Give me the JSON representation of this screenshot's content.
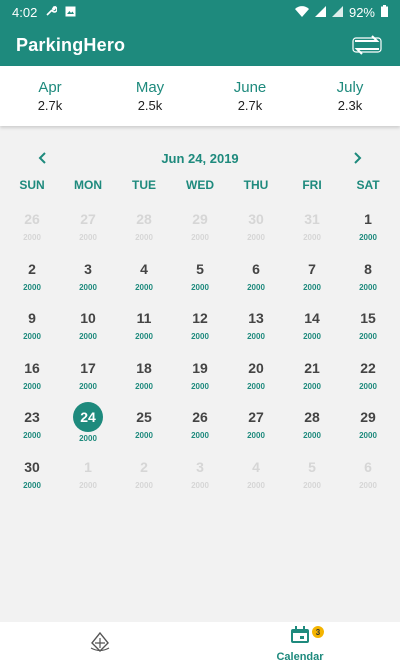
{
  "status_bar": {
    "time": "4:02",
    "battery": "92%"
  },
  "app_bar": {
    "title": "ParkingHero"
  },
  "months": [
    {
      "name": "Apr",
      "value": "2.7k"
    },
    {
      "name": "May",
      "value": "2.5k"
    },
    {
      "name": "June",
      "value": "2.7k"
    },
    {
      "name": "July",
      "value": "2.3k"
    }
  ],
  "calendar": {
    "current_date": "Jun 24, 2019",
    "weekdays": [
      "SUN",
      "MON",
      "TUE",
      "WED",
      "THU",
      "FRI",
      "SAT"
    ],
    "weeks": [
      [
        {
          "d": "26",
          "s": "2000",
          "m": true
        },
        {
          "d": "27",
          "s": "2000",
          "m": true
        },
        {
          "d": "28",
          "s": "2000",
          "m": true
        },
        {
          "d": "29",
          "s": "2000",
          "m": true
        },
        {
          "d": "30",
          "s": "2000",
          "m": true
        },
        {
          "d": "31",
          "s": "2000",
          "m": true
        },
        {
          "d": "1",
          "s": "2000",
          "m": false
        }
      ],
      [
        {
          "d": "2",
          "s": "2000",
          "m": false
        },
        {
          "d": "3",
          "s": "2000",
          "m": false
        },
        {
          "d": "4",
          "s": "2000",
          "m": false
        },
        {
          "d": "5",
          "s": "2000",
          "m": false
        },
        {
          "d": "6",
          "s": "2000",
          "m": false
        },
        {
          "d": "7",
          "s": "2000",
          "m": false
        },
        {
          "d": "8",
          "s": "2000",
          "m": false
        }
      ],
      [
        {
          "d": "9",
          "s": "2000",
          "m": false
        },
        {
          "d": "10",
          "s": "2000",
          "m": false
        },
        {
          "d": "11",
          "s": "2000",
          "m": false
        },
        {
          "d": "12",
          "s": "2000",
          "m": false
        },
        {
          "d": "13",
          "s": "2000",
          "m": false
        },
        {
          "d": "14",
          "s": "2000",
          "m": false
        },
        {
          "d": "15",
          "s": "2000",
          "m": false
        }
      ],
      [
        {
          "d": "16",
          "s": "2000",
          "m": false
        },
        {
          "d": "17",
          "s": "2000",
          "m": false
        },
        {
          "d": "18",
          "s": "2000",
          "m": false
        },
        {
          "d": "19",
          "s": "2000",
          "m": false
        },
        {
          "d": "20",
          "s": "2000",
          "m": false
        },
        {
          "d": "21",
          "s": "2000",
          "m": false
        },
        {
          "d": "22",
          "s": "2000",
          "m": false
        }
      ],
      [
        {
          "d": "23",
          "s": "2000",
          "m": false
        },
        {
          "d": "24",
          "s": "2000",
          "m": false,
          "sel": true
        },
        {
          "d": "25",
          "s": "2000",
          "m": false
        },
        {
          "d": "26",
          "s": "2000",
          "m": false
        },
        {
          "d": "27",
          "s": "2000",
          "m": false
        },
        {
          "d": "28",
          "s": "2000",
          "m": false
        },
        {
          "d": "29",
          "s": "2000",
          "m": false
        }
      ],
      [
        {
          "d": "30",
          "s": "2000",
          "m": false
        },
        {
          "d": "1",
          "s": "2000",
          "m": true
        },
        {
          "d": "2",
          "s": "2000",
          "m": true
        },
        {
          "d": "3",
          "s": "2000",
          "m": true
        },
        {
          "d": "4",
          "s": "2000",
          "m": true
        },
        {
          "d": "5",
          "s": "2000",
          "m": true
        },
        {
          "d": "6",
          "s": "2000",
          "m": true
        }
      ]
    ]
  },
  "bottom_nav": {
    "items": [
      {
        "icon": "app-logo-icon",
        "label": ""
      },
      {
        "icon": "calendar-icon",
        "label": "Calendar",
        "badge": "3"
      }
    ]
  },
  "colors": {
    "primary": "#1e8a7d",
    "muted_text": "#d6d6d6",
    "badge": "#f4b400"
  }
}
